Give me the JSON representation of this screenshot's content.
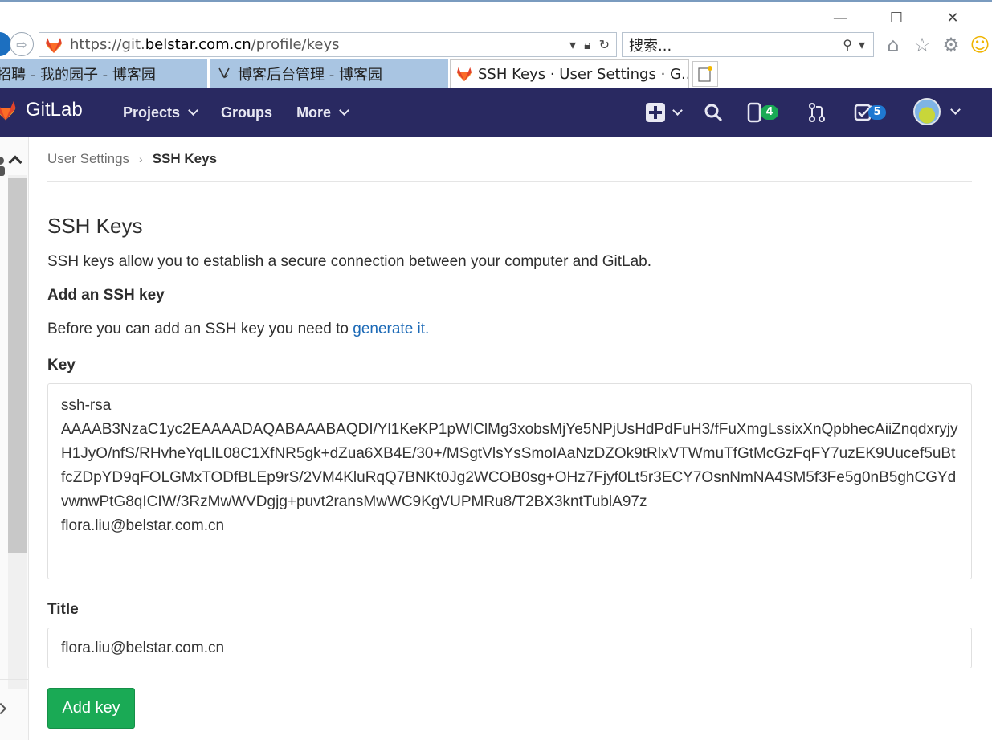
{
  "browser": {
    "url_prefix": "https://git.",
    "url_host": "belstar.com.cn",
    "url_path": "/profile/keys",
    "search_placeholder": "搜索...",
    "tabs": [
      {
        "label": "招聘 - 我的园子 - 博客园"
      },
      {
        "label": "博客后台管理 - 博客园"
      },
      {
        "label": "SSH Keys · User Settings · G..."
      }
    ]
  },
  "navbar": {
    "brand": "GitLab",
    "menu": [
      {
        "label": "Projects"
      },
      {
        "label": "Groups"
      },
      {
        "label": "More"
      }
    ],
    "issues_count": "4",
    "todos_count": "5"
  },
  "breadcrumb": {
    "parent": "User Settings",
    "current": "SSH Keys"
  },
  "page": {
    "title": "SSH Keys",
    "description": "SSH keys allow you to establish a secure connection between your computer and GitLab.",
    "add_heading": "Add an SSH key",
    "hint_prefix": "Before you can add an SSH key you need to ",
    "hint_link": "generate it."
  },
  "form": {
    "key_label": "Key",
    "key_value": "ssh-rsa\nAAAAB3NzaC1yc2EAAAADAQABAAABAQDI/Yl1KeKP1pWlClMg3xobsMjYe5NPjUsHdPdFuH3/fFuXmgLssixXnQpbhecAiiZnqdxryjyH1JyO/nfS/RHvheYqLlL08C1XfNR5gk+dZua6XB4E/30+/MSgtVlsYsSmoIAaNzDZOk9tRlxVTWmuTfGtMcGzFqFY7uzEK9Uucef5uBtfcZDpYD9qFOLGMxTODfBLEp9rS/2VM4KluRqQ7BNKt0Jg2WCOB0sg+OHz7Fjyf0Lt5r3ECY7OsnNmNA4SM5f3Fe5g0nB5ghCGYdvwnwPtG8qICIW/3RzMwWVDgjg+puvt2ransMwWC9KgVUPMRu8/T2BX3kntTublA97z\nflora.liu@belstar.com.cn",
    "title_label": "Title",
    "title_value": "flora.liu@belstar.com.cn",
    "submit_label": "Add key"
  },
  "colors": {
    "navbar_bg": "#292961",
    "submit_bg": "#1aaa55",
    "link": "#1b69b6",
    "badge_green": "#1aaa55",
    "badge_blue": "#1f78d1"
  }
}
